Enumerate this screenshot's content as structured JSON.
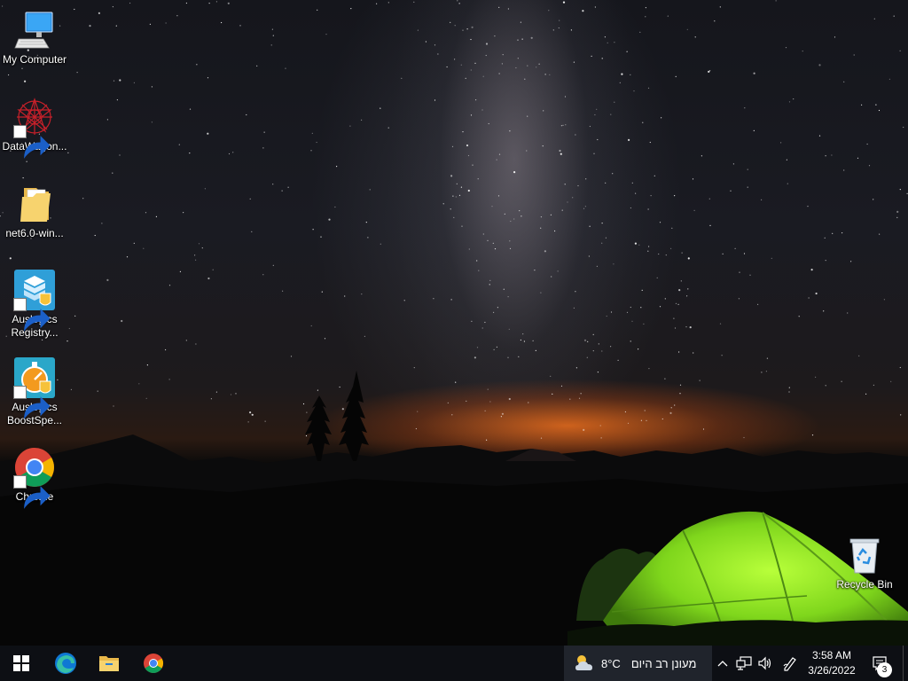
{
  "desktop": {
    "icons": [
      {
        "label": "My Computer",
        "icon": "monitor-icon"
      },
      {
        "label": "DataWagon...",
        "icon": "datawagon-icon"
      },
      {
        "label": "net6.0-win...",
        "icon": "folder-icon"
      },
      {
        "label": "Auslogics Registry...",
        "line1": "Auslogics",
        "line2": "Registry...",
        "icon": "auslogics-registry-icon"
      },
      {
        "label": "Auslogics BoostSpe...",
        "line1": "Auslogics",
        "line2": "BoostSpe...",
        "icon": "auslogics-boostspeed-icon"
      },
      {
        "label": "Chrome",
        "icon": "chrome-icon"
      },
      {
        "label": "Recycle Bin",
        "icon": "recycle-bin-icon"
      }
    ]
  },
  "taskbar": {
    "pinned": [
      "windows-start-icon",
      "edge-icon",
      "file-explorer-icon",
      "chrome-icon"
    ],
    "weather": {
      "temp": "8°C",
      "text": "מעונן רב היום",
      "icon": "partly-cloudy-icon"
    },
    "tray_icons": [
      "chevron-up-icon",
      "network-icon",
      "volume-icon",
      "pen-icon"
    ],
    "clock": {
      "time": "3:58 AM",
      "date": "3/26/2022"
    },
    "notifications": {
      "count": "3",
      "icon": "action-center-icon"
    }
  },
  "colors": {
    "taskbar_bg": "#0d0f14",
    "weather_bg": "#20242c",
    "tent_green": "#8fe02a",
    "horizon_glow": "#e86e1e"
  }
}
